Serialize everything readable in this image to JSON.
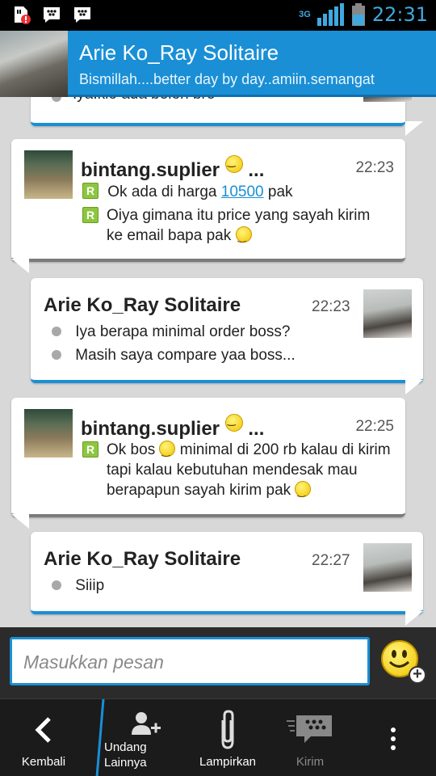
{
  "status_bar": {
    "network": "3G",
    "time": "22:31"
  },
  "header": {
    "contact_name": "Arie Ko_Ray Solitaire",
    "personal_message": "Bismillah....better day by day..amiin.semangat"
  },
  "chat": {
    "partial_top_text": "Iya.klo ada boleh bro",
    "messages": [
      {
        "direction": "in",
        "sender": "bintang.suplier",
        "time": "22:23",
        "lines": [
          {
            "pre": "Ok ada di harga ",
            "link": "10500",
            "post": " pak"
          },
          {
            "text": "Oiya gimana itu price yang sayah kirim ke email bapa pak"
          }
        ]
      },
      {
        "direction": "out",
        "sender": "Arie Ko_Ray Solitaire",
        "time": "22:23",
        "lines": [
          {
            "text": "Iya berapa minimal order boss?"
          },
          {
            "text": "Masih saya compare yaa boss..."
          }
        ]
      },
      {
        "direction": "in",
        "sender": "bintang.suplier",
        "time": "22:25",
        "lines": [
          {
            "pre": "Ok bos ",
            "post": "  minimal di 200 rb kalau di kirim tapi kalau kebutuhan mendesak mau berapapun sayah kirim pak"
          }
        ]
      },
      {
        "direction": "out",
        "sender": "Arie Ko_Ray Solitaire",
        "time": "22:27",
        "lines": [
          {
            "text": "Siiip"
          }
        ]
      }
    ]
  },
  "input": {
    "placeholder": "Masukkan pesan"
  },
  "bottom_bar": {
    "back_label": "Kembali",
    "invite_label_1": "Undang",
    "invite_label_2": "Lainnya",
    "attach_label": "Lampirkan",
    "send_label": "Kirim"
  },
  "colors": {
    "accent": "#1a8fd6",
    "header": "#1a8fd6",
    "status_text": "#3fa9e0"
  }
}
